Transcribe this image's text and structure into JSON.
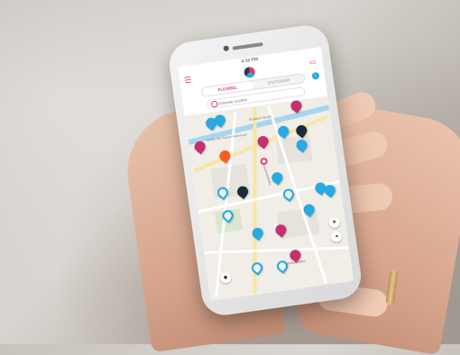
{
  "status_bar": {
    "time": "4:16 PM"
  },
  "tabs": [
    {
      "label": "FLEXIBEL",
      "active": true
    },
    {
      "label": "STATIONÄR",
      "active": false
    }
  ],
  "search": {
    "placeholder": "Adresse suchen"
  },
  "map": {
    "street_labels": [
      "Straße der Pariser Kommune",
      "Stralauer Straße",
      "Andreasstraße",
      "Karl-Marx-Allee"
    ]
  },
  "colors": {
    "accent": "#e8337a",
    "flexible_pin": "#28a9e1",
    "station_pin": "#c2326e",
    "selected_pin": "#1f2a36"
  },
  "icons": [
    "menu-icon",
    "app-logo-icon",
    "car-icon",
    "info-icon",
    "search-icon",
    "locate-icon",
    "compass-icon"
  ]
}
